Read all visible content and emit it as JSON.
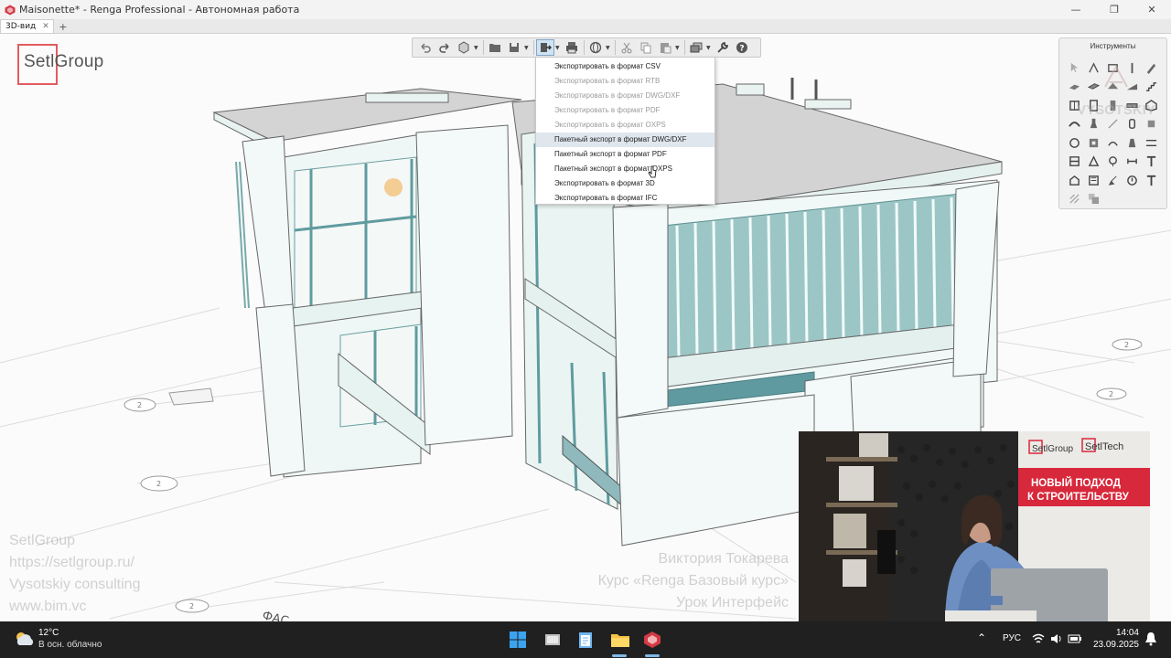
{
  "window": {
    "title": "Maisonette* - Renga Professional - Автономная работа",
    "minimize_icon": "minimize-icon",
    "maximize_icon": "restore-icon",
    "close_icon": "close-icon"
  },
  "tabs": [
    {
      "label": "3D-вид",
      "active": true
    }
  ],
  "logo": {
    "text": "SetlGroup",
    "color": "#e25b62"
  },
  "export_menu": {
    "items": [
      {
        "label": "Экспортировать в формат CSV",
        "enabled": true
      },
      {
        "label": "Экспортировать в формат RTB",
        "enabled": false
      },
      {
        "label": "Экспортировать в формат DWG/DXF",
        "enabled": false
      },
      {
        "label": "Экспортировать в формат PDF",
        "enabled": false
      },
      {
        "label": "Экспортировать в формат OXPS",
        "enabled": false
      },
      {
        "label": "Пакетный экспорт в формат DWG/DXF",
        "enabled": true,
        "highlighted": true
      },
      {
        "label": "Пакетный экспорт в формат PDF",
        "enabled": true
      },
      {
        "label": "Пакетный экспорт в формат OXPS",
        "enabled": true
      },
      {
        "label": "Экспортировать в формат 3D",
        "enabled": true
      },
      {
        "label": "Экспортировать в формат IFC",
        "enabled": true
      }
    ]
  },
  "tools_panel": {
    "title": "Инструменты",
    "watermark": "VYSOTSKIY"
  },
  "overlay_left": [
    "SetlGroup",
    "https://setlgroup.ru/",
    "Vysotskiy consulting",
    "www.bim.vc"
  ],
  "overlay_right": [
    "Виктория Токарева",
    "Курс «Renga Базовый курс»",
    "Урок Интерфейс"
  ],
  "webcam": {
    "banner_logo_left": "SetlGroup",
    "banner_logo_right": "SetlTech",
    "banner_line1": "НОВЫЙ ПОДХОД",
    "banner_line2": "К СТРОИТЕЛЬСТВУ",
    "accent": "#d8283b"
  },
  "taskbar": {
    "weather_temp": "12°C",
    "weather_text": "В осн. облачно",
    "lang": "РУС",
    "time": "14:04",
    "date": "23.09.2025"
  },
  "axis_markers": [
    "2",
    "2",
    "2",
    "2",
    "2"
  ],
  "floor_label": "ФАС"
}
